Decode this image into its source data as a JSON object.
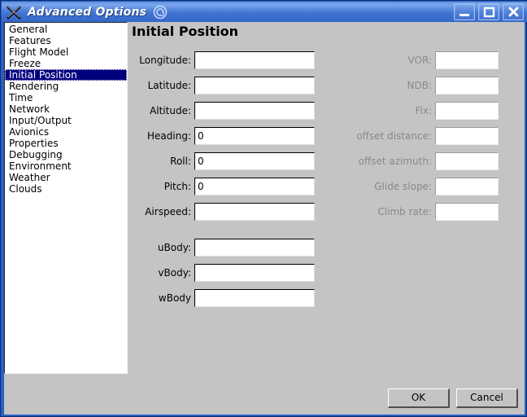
{
  "window": {
    "title": "Advanced Options",
    "app_icon": "x11-logo-icon",
    "shade_icon": "shade-spiral-icon",
    "controls": {
      "minimize_label": "Minimize",
      "maximize_label": "Maximize",
      "close_label": "Close"
    },
    "colors": {
      "titlebar_light": "#7aa7ec",
      "titlebar_dark": "#3568c8",
      "frame_border": "#2b5fc4",
      "client_background": "#c4c4c4",
      "selection": "#00007f",
      "disabled_text": "#898989"
    }
  },
  "sidebar": {
    "selected": "Initial Position",
    "items": [
      {
        "label": "General"
      },
      {
        "label": "Features"
      },
      {
        "label": "Flight Model"
      },
      {
        "label": "Freeze"
      },
      {
        "label": "Initial Position"
      },
      {
        "label": "Rendering"
      },
      {
        "label": "Time"
      },
      {
        "label": "Network"
      },
      {
        "label": "Input/Output"
      },
      {
        "label": "Avionics"
      },
      {
        "label": "Properties"
      },
      {
        "label": "Debugging"
      },
      {
        "label": "Environment"
      },
      {
        "label": "Weather"
      },
      {
        "label": "Clouds"
      }
    ]
  },
  "panel": {
    "title": "Initial Position",
    "left_fields": [
      {
        "label": "Longitude:",
        "value": "",
        "disabled": false
      },
      {
        "label": "Latitude:",
        "value": "",
        "disabled": false
      },
      {
        "label": "Altitude:",
        "value": "",
        "disabled": false
      },
      {
        "label": "Heading:",
        "value": "0",
        "disabled": false
      },
      {
        "label": "Roll:",
        "value": "0",
        "disabled": false
      },
      {
        "label": "Pitch:",
        "value": "0",
        "disabled": false
      },
      {
        "label": "Airspeed:",
        "value": "",
        "disabled": false
      },
      {
        "label": "uBody:",
        "value": "",
        "disabled": false
      },
      {
        "label": "vBody:",
        "value": "",
        "disabled": false
      },
      {
        "label": "wBody",
        "value": "",
        "disabled": false
      }
    ],
    "right_fields": [
      {
        "label": "VOR:",
        "value": "",
        "disabled": true
      },
      {
        "label": "NDB:",
        "value": "",
        "disabled": true
      },
      {
        "label": "Fix:",
        "value": "",
        "disabled": true
      },
      {
        "label": "offset distance:",
        "value": "",
        "disabled": true
      },
      {
        "label": "offset azimuth:",
        "value": "",
        "disabled": true
      },
      {
        "label": "Glide slope:",
        "value": "",
        "disabled": true
      },
      {
        "label": "Climb rate:",
        "value": "",
        "disabled": true
      }
    ]
  },
  "buttons": {
    "ok": "OK",
    "cancel": "Cancel"
  }
}
